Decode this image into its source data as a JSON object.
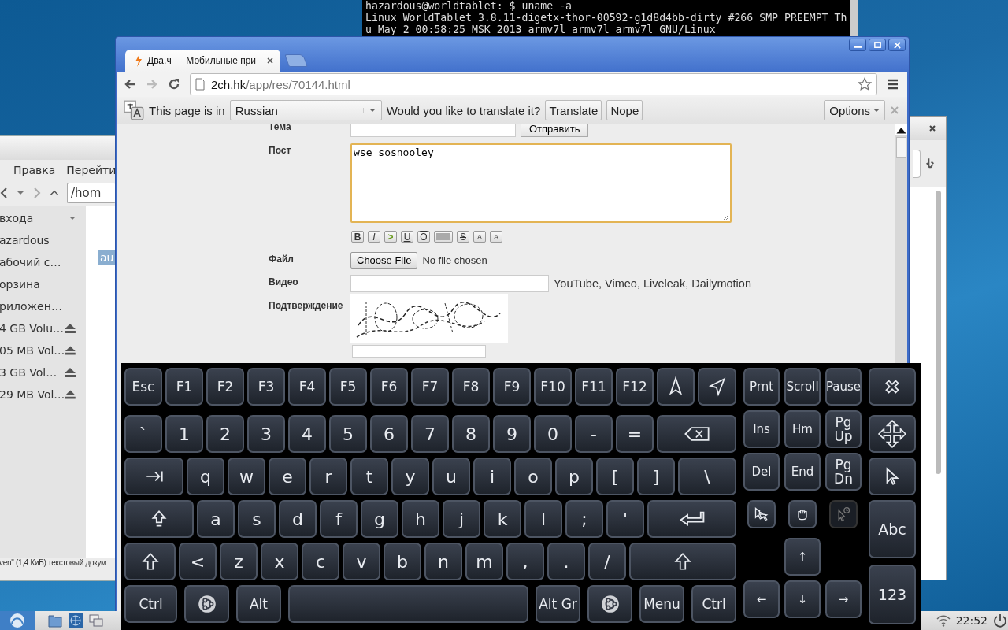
{
  "terminal": {
    "lines": [
      "hazardous@worldtablet: $ uname -a",
      "Linux WorldTablet 3.8.11-digetx-thor-00592-g1d8d4bb-dirty #266 SMP PREEMPT Th",
      "u May 2 00:58:25 MSK 2013 armv7l armv7l armv7l GNU/Linux"
    ]
  },
  "file_manager": {
    "menu": [
      "Правка",
      "Перейти"
    ],
    "path": "/hom",
    "places": [
      {
        "label": "входа",
        "kind": "header"
      },
      {
        "label": "azardous",
        "kind": "place"
      },
      {
        "label": "абочий с…",
        "kind": "place"
      },
      {
        "label": "орзина",
        "kind": "place"
      },
      {
        "label": "риложен…",
        "kind": "place"
      },
      {
        "label": "4 GB Volu…",
        "kind": "volume"
      },
      {
        "label": "05 MB Vol…",
        "kind": "volume"
      },
      {
        "label": "3 GB Vol…",
        "kind": "volume"
      },
      {
        "label": "29 MB Vol…",
        "kind": "volume"
      }
    ],
    "selected_file": "au",
    "status": "ven\" (1,4 КиБ) текстовый докум"
  },
  "browser": {
    "tab": {
      "title": "Два.ч — Мобильные при"
    },
    "url": {
      "host": "2ch.hk",
      "path": "/app/res/70144.html"
    },
    "translate_bar": {
      "prefix": "This page is in",
      "language": "Russian",
      "question": "Would you like to translate it?",
      "buttons": [
        "Translate",
        "Nope"
      ],
      "options": "Options"
    },
    "form": {
      "rows": [
        {
          "label": "Тема",
          "kind": "subject",
          "button": "Отправить"
        },
        {
          "label": "Пост",
          "kind": "post",
          "value": "wse sosnooley"
        },
        {
          "label": "Файл",
          "kind": "file",
          "button": "Choose File",
          "note": "No file chosen"
        },
        {
          "label": "Видео",
          "kind": "video",
          "note": "YouTube, Vimeo, Liveleak, Dailymotion"
        },
        {
          "label": "Подтверждение",
          "kind": "captcha"
        }
      ],
      "format_buttons": [
        {
          "label": "B",
          "kind": "bold"
        },
        {
          "label": "I",
          "kind": "italic"
        },
        {
          "label": ">",
          "kind": "quote"
        },
        {
          "label": "U",
          "kind": "underline"
        },
        {
          "label": "O",
          "kind": "overline"
        },
        {
          "kind": "spoiler"
        },
        {
          "label": "S",
          "kind": "strike"
        },
        {
          "label": "A",
          "kind": "sup"
        },
        {
          "label": "A",
          "kind": "sub"
        }
      ]
    }
  },
  "keyboard": {
    "main_rows": [
      [
        {
          "label": "Esc"
        },
        {
          "label": "F1"
        },
        {
          "label": "F2"
        },
        {
          "label": "F3"
        },
        {
          "label": "F4"
        },
        {
          "label": "F5"
        },
        {
          "label": "F6"
        },
        {
          "label": "F7"
        },
        {
          "label": "F8"
        },
        {
          "label": "F9"
        },
        {
          "label": "F10"
        },
        {
          "label": "F11"
        },
        {
          "label": "F12"
        },
        {
          "kind": "cursorup"
        },
        {
          "kind": "cursortilt"
        }
      ],
      [
        {
          "label": "`"
        },
        {
          "label": "1"
        },
        {
          "label": "2"
        },
        {
          "label": "3"
        },
        {
          "label": "4"
        },
        {
          "label": "5"
        },
        {
          "label": "6"
        },
        {
          "label": "7"
        },
        {
          "label": "8"
        },
        {
          "label": "9"
        },
        {
          "label": "0"
        },
        {
          "label": "-"
        },
        {
          "label": "="
        },
        {
          "kind": "backspace"
        }
      ],
      [
        {
          "kind": "tab"
        },
        {
          "label": "q"
        },
        {
          "label": "w"
        },
        {
          "label": "e"
        },
        {
          "label": "r"
        },
        {
          "label": "t"
        },
        {
          "label": "y"
        },
        {
          "label": "u"
        },
        {
          "label": "i"
        },
        {
          "label": "o"
        },
        {
          "label": "p"
        },
        {
          "label": "["
        },
        {
          "label": "]"
        },
        {
          "label": "\\"
        }
      ],
      [
        {
          "kind": "caps"
        },
        {
          "label": "a"
        },
        {
          "label": "s"
        },
        {
          "label": "d"
        },
        {
          "label": "f"
        },
        {
          "label": "g"
        },
        {
          "label": "h"
        },
        {
          "label": "j"
        },
        {
          "label": "k"
        },
        {
          "label": "l"
        },
        {
          "label": ";"
        },
        {
          "label": "'"
        },
        {
          "kind": "enter"
        }
      ],
      [
        {
          "kind": "shift"
        },
        {
          "label": "<"
        },
        {
          "label": "z"
        },
        {
          "label": "x"
        },
        {
          "label": "c"
        },
        {
          "label": "v"
        },
        {
          "label": "b"
        },
        {
          "label": "n"
        },
        {
          "label": "m"
        },
        {
          "label": ","
        },
        {
          "label": "."
        },
        {
          "label": "/"
        },
        {
          "kind": "shift"
        }
      ],
      [
        {
          "label": "Ctrl"
        },
        {
          "kind": "super"
        },
        {
          "label": "Alt"
        },
        {
          "kind": "space"
        },
        {
          "label": "Alt Gr"
        },
        {
          "kind": "super"
        },
        {
          "label": "Menu"
        },
        {
          "label": "Ctrl"
        }
      ]
    ],
    "nav_rows": [
      [
        {
          "label": "Prnt"
        },
        {
          "label": "Scroll"
        },
        {
          "label": "Pause"
        }
      ],
      [
        {
          "label": "Ins"
        },
        {
          "label": "Hm"
        },
        {
          "label": "Pg Up"
        }
      ],
      [
        {
          "label": "Del"
        },
        {
          "label": "End"
        },
        {
          "label": "Pg Dn"
        }
      ],
      [
        {
          "kind": "clickdouble",
          "disabled": false
        },
        {
          "kind": "drag",
          "disabled": false
        },
        {
          "kind": "hover",
          "disabled": true
        }
      ],
      [
        {
          "label": "↑"
        }
      ],
      [
        {
          "label": "←"
        },
        {
          "label": "↓"
        },
        {
          "label": "→"
        }
      ]
    ],
    "side_keys": [
      {
        "kind": "close"
      },
      {
        "kind": "move"
      },
      {
        "kind": "pointer"
      },
      {
        "label": "Abc"
      },
      {
        "label": "123"
      }
    ]
  },
  "taskbar": {
    "clock": "22:52"
  }
}
